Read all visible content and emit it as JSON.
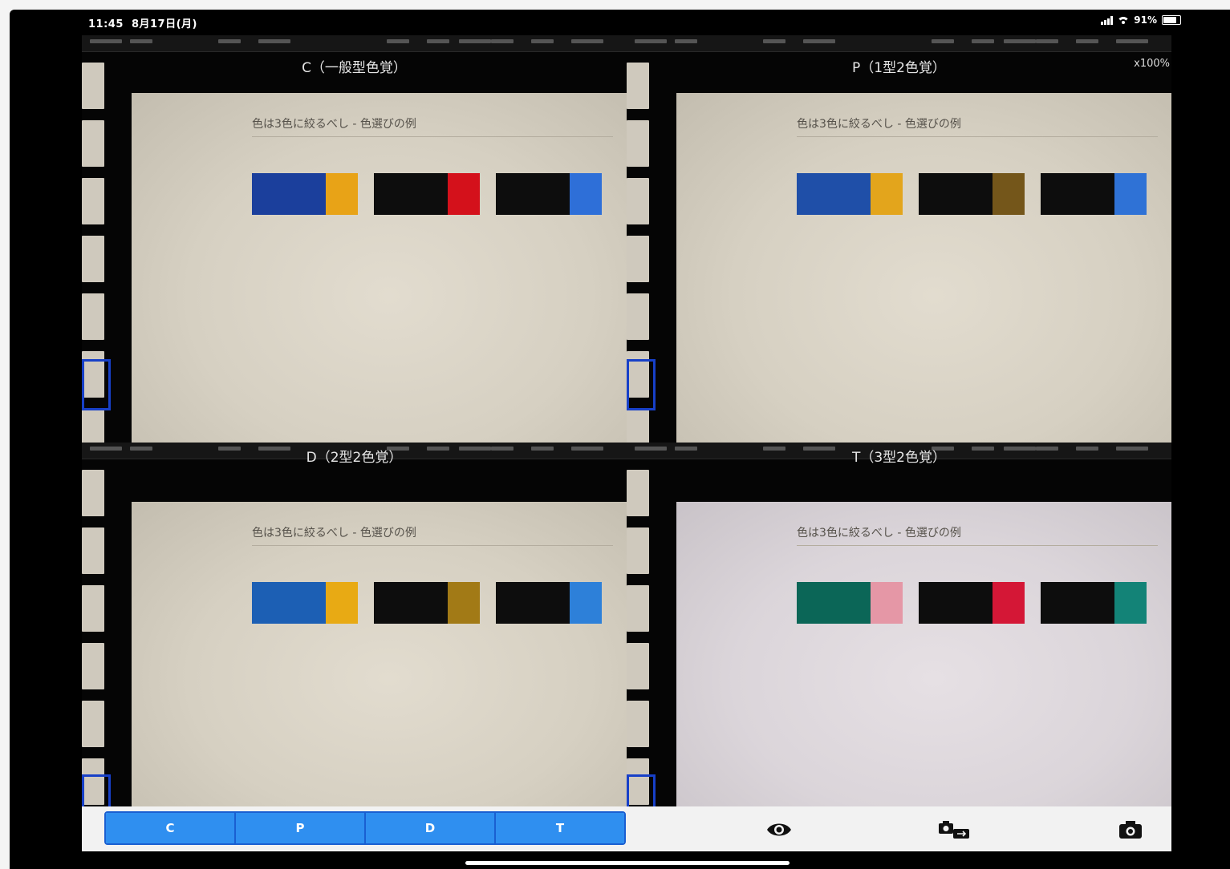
{
  "status_bar": {
    "time": "11:45",
    "date": "8月17日(月)",
    "battery": "91%",
    "battery_level": 0.91
  },
  "views": [
    {
      "id": "c",
      "title": "C（一般型色覚）",
      "slide_title": "色は3色に絞るべし - 色選びの例",
      "swatches": [
        {
          "main": "#1b3f9c",
          "accent": "#e8a317"
        },
        {
          "main": "#0d0d0d",
          "accent": "#d4111b"
        },
        {
          "main": "#0d0d0d",
          "accent": "#2e6fd8"
        }
      ]
    },
    {
      "id": "p",
      "title": "P（1型2色覚）",
      "zoom": "x100%",
      "slide_title": "色は3色に絞るべし - 色選びの例",
      "swatches": [
        {
          "main": "#1f4fa8",
          "accent": "#e3a51c"
        },
        {
          "main": "#0d0d0d",
          "accent": "#74561a"
        },
        {
          "main": "#0d0d0d",
          "accent": "#2f72d6"
        }
      ]
    },
    {
      "id": "d",
      "title": "D（2型2色覚）",
      "slide_title": "色は3色に絞るべし - 色選びの例",
      "swatches": [
        {
          "main": "#1c5fb4",
          "accent": "#e8aa14"
        },
        {
          "main": "#0d0d0d",
          "accent": "#a27a16"
        },
        {
          "main": "#0d0d0d",
          "accent": "#2d80d9"
        }
      ]
    },
    {
      "id": "t",
      "title": "T（3型2色覚）",
      "slide_title": "色は3色に絞るべし - 色選びの例",
      "swatches": [
        {
          "main": "#0b6657",
          "accent": "#e597a6"
        },
        {
          "main": "#0d0d0d",
          "accent": "#d41736"
        },
        {
          "main": "#0d0d0d",
          "accent": "#138377"
        }
      ]
    }
  ],
  "toolbar": {
    "segments": [
      "C",
      "P",
      "D",
      "T"
    ],
    "icons": [
      "eye-icon",
      "camera-switch-icon",
      "camera-icon"
    ],
    "accent": "#2f8ff0"
  }
}
